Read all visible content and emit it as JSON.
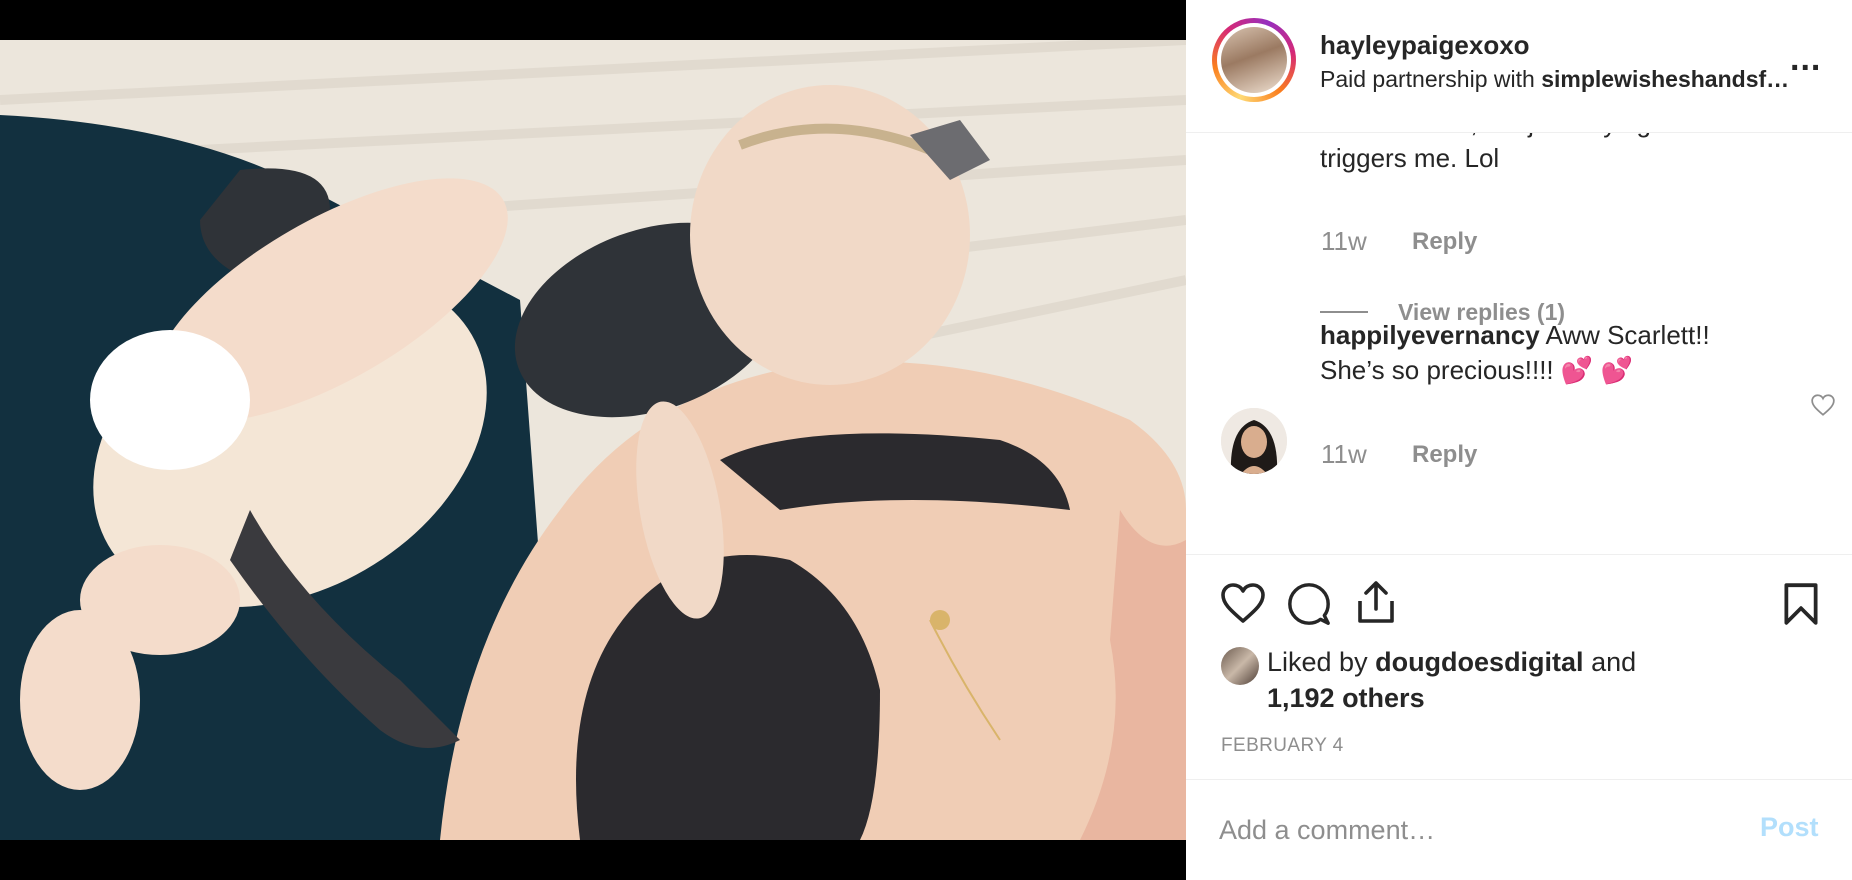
{
  "post": {
    "username": "hayleypaigexoxo",
    "partnership_prefix": "Paid partnership with ",
    "partnership_brand": "simplewisheshandsf…",
    "more_label": "..."
  },
  "comments": {
    "previous": {
      "line1": "because well, but just saying... it",
      "line2": "triggers me. Lol",
      "time": "11w",
      "reply_label": "Reply",
      "view_replies_label": "View replies (1)"
    },
    "current": {
      "author": "happilyevernancy",
      "line1_text": " Aww Scarlett!!",
      "line2_text": "She’s so precious!!!! 💕 💕",
      "time": "11w",
      "reply_label": "Reply"
    }
  },
  "likes": {
    "prefix": "Liked by ",
    "user": "dougdoesdigital",
    "suffix": " and",
    "others": "1,192 others"
  },
  "date": "FEBRUARY 4",
  "add_comment": {
    "placeholder": "Add a comment…",
    "post_label": "Post"
  },
  "icons": [
    "heart-icon",
    "comment-icon",
    "share-icon",
    "bookmark-icon",
    "more-icon"
  ],
  "colors": {
    "accent_disabled": "#b2dffc",
    "secondary_text": "#8e8e8e",
    "primary_text": "#262626"
  }
}
